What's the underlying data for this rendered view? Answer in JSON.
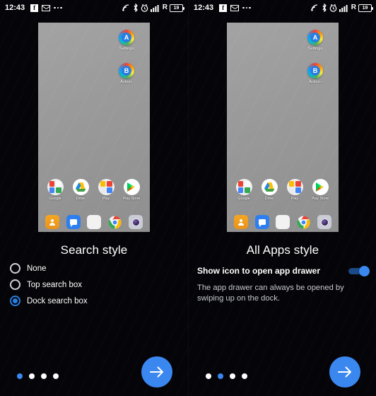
{
  "status_bar": {
    "time": "12:43",
    "left_icons": [
      "facebook-icon",
      "gmail-icon",
      "overflow-dots-icon"
    ],
    "right_icons": [
      "cast-icon",
      "bluetooth-icon",
      "alarm-icon",
      "signal-icon"
    ],
    "roaming_label": "R",
    "battery_level": "19"
  },
  "phone_preview": {
    "homescreen_icons": [
      {
        "label": "Settings",
        "letter": "A"
      },
      {
        "label": "Action-",
        "letter": "B"
      }
    ],
    "app_row": [
      {
        "label": "Google",
        "icon": "google-folder-icon"
      },
      {
        "label": "Drive",
        "icon": "drive-icon"
      },
      {
        "label": "Play",
        "icon": "play-folder-icon"
      },
      {
        "label": "Play Store",
        "icon": "play-store-icon"
      }
    ],
    "dock": [
      {
        "name": "contacts-icon"
      },
      {
        "name": "messages-icon"
      },
      {
        "name": "app-drawer-icon"
      },
      {
        "name": "chrome-icon"
      },
      {
        "name": "camera-icon"
      }
    ],
    "search_widget": {
      "logo": "google-g-icon",
      "mic": "microphone-icon"
    }
  },
  "panels": [
    {
      "title": "Search style",
      "options": [
        {
          "label": "None",
          "selected": false
        },
        {
          "label": "Top search box",
          "selected": false
        },
        {
          "label": "Dock search box",
          "selected": true
        }
      ],
      "page_dots": {
        "count": 4,
        "active_index": 0
      },
      "next_button": "arrow-right-icon"
    },
    {
      "title": "All Apps style",
      "switch": {
        "label": "Show icon to open app drawer",
        "enabled": true
      },
      "description": "The app drawer can always be opened by swiping up on the dock.",
      "page_dots": {
        "count": 4,
        "active_index": 1
      },
      "next_button": "arrow-right-icon"
    }
  ],
  "colors": {
    "accent": "#3b87f0",
    "radio_selected": "#2a7de1",
    "background": "#050509",
    "text": "#ffffff",
    "muted_text": "#c6c9cd"
  }
}
